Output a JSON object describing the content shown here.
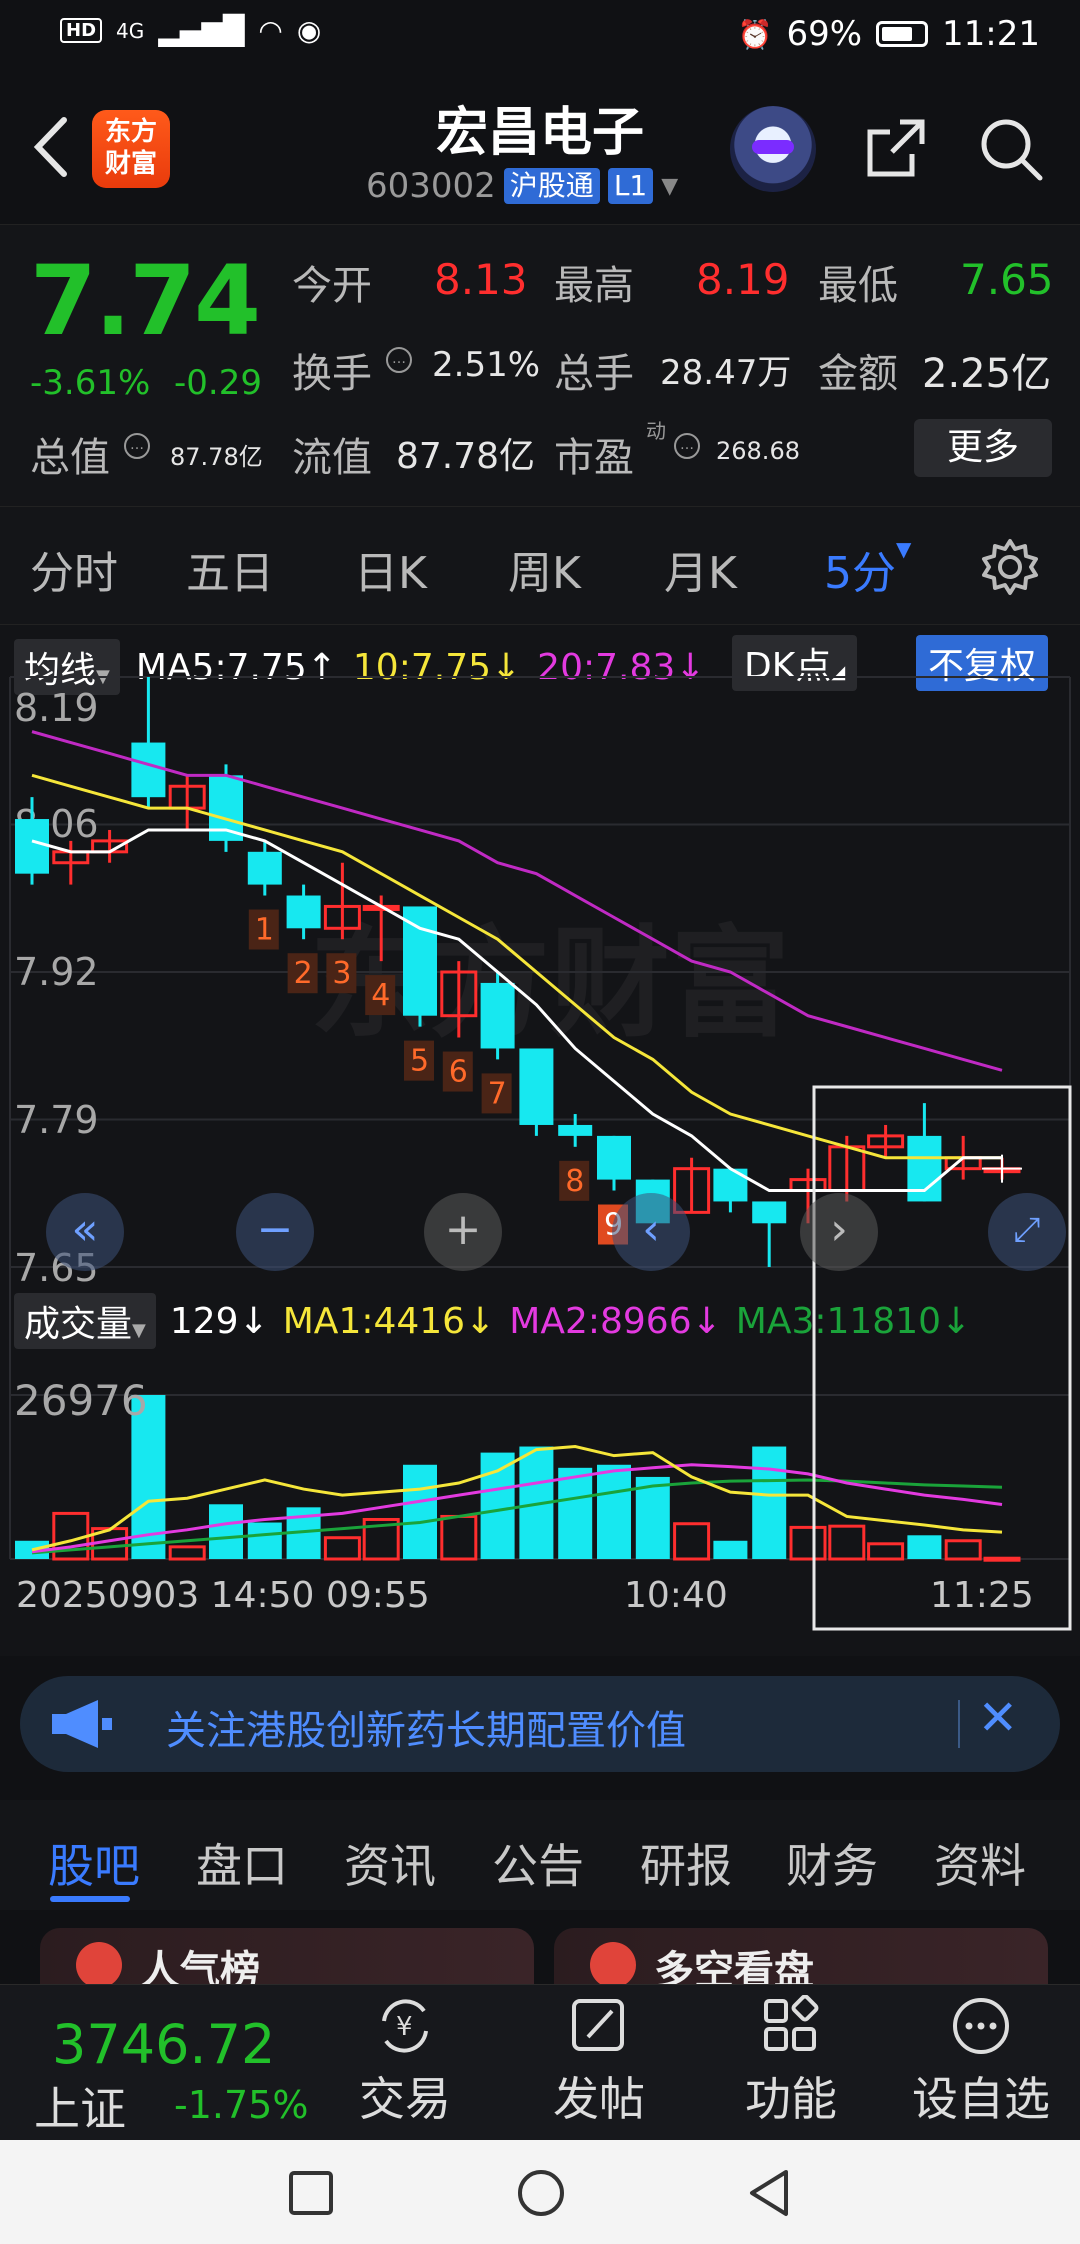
{
  "status_bar": {
    "network": "4G",
    "hd": "HD",
    "battery": "69%",
    "time": "11:21"
  },
  "header": {
    "logo_line1": "东方",
    "logo_line2": "财富",
    "stock_name": "宏昌电子",
    "stock_code": "603002",
    "tag_market": "沪股通",
    "tag_level": "L1"
  },
  "quote": {
    "price": "7.74",
    "change_pct": "-3.61%",
    "change_abs": "-0.29",
    "labels": {
      "open": "今开",
      "high": "最高",
      "low": "最低",
      "turnover": "换手",
      "volume": "总手",
      "amount": "金额",
      "total_cap": "总值",
      "float_cap": "流值",
      "pe": "市盈",
      "pe_sup": "动"
    },
    "values": {
      "open": "8.13",
      "high": "8.19",
      "low": "7.65",
      "turnover": "2.51%",
      "volume": "28.47万",
      "amount": "2.25亿",
      "total_cap": "87.78亿",
      "float_cap": "87.78亿",
      "pe": "268.68"
    },
    "more_label": "更多"
  },
  "period_tabs": [
    "分时",
    "五日",
    "日K",
    "周K",
    "月K",
    "5分"
  ],
  "chart_header": {
    "ma_button": "均线",
    "ma5": "MA5:7.75↑",
    "ma10": "10:7.75↓",
    "ma20": "20:7.83↓",
    "dk_button": "DK点",
    "adjust_button": "不复权"
  },
  "price_axis": [
    "8.19",
    "8.06",
    "7.92",
    "7.79",
    "7.65"
  ],
  "volume_header": {
    "label": "成交量",
    "current": "129↓",
    "ma1": "MA1:4416↓",
    "ma2": "MA2:8966↓",
    "ma3": "MA3:11810↓"
  },
  "volume_axis_max": "26976",
  "time_axis": {
    "start": "20250903 14:50",
    "t1": "09:55",
    "t2": "10:40",
    "t3": "11:25"
  },
  "watermark": "东方财富",
  "chart_data": {
    "type": "candlestick",
    "ylim": [
      7.65,
      8.19
    ],
    "candles": [
      {
        "o": 8.06,
        "c": 8.01,
        "h": 8.08,
        "l": 8.0,
        "v": 3000,
        "n": ""
      },
      {
        "o": 8.02,
        "c": 8.03,
        "h": 8.04,
        "l": 8.0,
        "v": 7500,
        "n": ""
      },
      {
        "o": 8.03,
        "c": 8.04,
        "h": 8.05,
        "l": 8.02,
        "v": 5000,
        "n": ""
      },
      {
        "o": 8.13,
        "c": 8.08,
        "h": 8.19,
        "l": 8.07,
        "v": 26976,
        "n": ""
      },
      {
        "o": 8.07,
        "c": 8.09,
        "h": 8.1,
        "l": 8.05,
        "v": 2000,
        "n": ""
      },
      {
        "o": 8.1,
        "c": 8.04,
        "h": 8.11,
        "l": 8.03,
        "v": 9000,
        "n": ""
      },
      {
        "o": 8.03,
        "c": 8.0,
        "h": 8.04,
        "l": 7.99,
        "v": 6000,
        "n": "1"
      },
      {
        "o": 7.99,
        "c": 7.96,
        "h": 8.0,
        "l": 7.95,
        "v": 8500,
        "n": "2"
      },
      {
        "o": 7.96,
        "c": 7.98,
        "h": 8.02,
        "l": 7.95,
        "v": 3500,
        "n": "3"
      },
      {
        "o": 7.98,
        "c": 7.98,
        "h": 7.99,
        "l": 7.93,
        "v": 6500,
        "n": "4"
      },
      {
        "o": 7.98,
        "c": 7.88,
        "h": 7.98,
        "l": 7.87,
        "v": 15500,
        "n": "5"
      },
      {
        "o": 7.88,
        "c": 7.92,
        "h": 7.93,
        "l": 7.86,
        "v": 7000,
        "n": "6"
      },
      {
        "o": 7.91,
        "c": 7.85,
        "h": 7.92,
        "l": 7.84,
        "v": 17500,
        "n": "7"
      },
      {
        "o": 7.85,
        "c": 7.78,
        "h": 7.85,
        "l": 7.77,
        "v": 18500,
        "n": ""
      },
      {
        "o": 7.78,
        "c": 7.77,
        "h": 7.79,
        "l": 7.76,
        "v": 15000,
        "n": "8"
      },
      {
        "o": 7.77,
        "c": 7.73,
        "h": 7.77,
        "l": 7.72,
        "v": 15500,
        "n": "9"
      },
      {
        "o": 7.73,
        "c": 7.69,
        "h": 7.73,
        "l": 7.69,
        "v": 13500,
        "n": ""
      },
      {
        "o": 7.7,
        "c": 7.74,
        "h": 7.75,
        "l": 7.7,
        "v": 5800,
        "n": ""
      },
      {
        "o": 7.74,
        "c": 7.71,
        "h": 7.74,
        "l": 7.7,
        "v": 3000,
        "n": ""
      },
      {
        "o": 7.71,
        "c": 7.69,
        "h": 7.71,
        "l": 7.65,
        "v": 18500,
        "n": ""
      },
      {
        "o": 7.72,
        "c": 7.73,
        "h": 7.74,
        "l": 7.69,
        "v": 5200,
        "n": ""
      },
      {
        "o": 7.72,
        "c": 7.76,
        "h": 7.77,
        "l": 7.71,
        "v": 5400,
        "n": ""
      },
      {
        "o": 7.76,
        "c": 7.77,
        "h": 7.78,
        "l": 7.75,
        "v": 2500,
        "n": ""
      },
      {
        "o": 7.77,
        "c": 7.71,
        "h": 7.8,
        "l": 7.71,
        "v": 3900,
        "n": ""
      },
      {
        "o": 7.74,
        "c": 7.75,
        "h": 7.77,
        "l": 7.73,
        "v": 3000,
        "n": ""
      },
      {
        "o": 7.74,
        "c": 7.74,
        "h": 7.75,
        "l": 7.73,
        "v": 129,
        "n": ""
      }
    ],
    "ma5": [
      8.04,
      8.03,
      8.03,
      8.05,
      8.05,
      8.05,
      8.04,
      8.02,
      8.0,
      7.98,
      7.96,
      7.95,
      7.92,
      7.89,
      7.85,
      7.82,
      7.79,
      7.77,
      7.74,
      7.72,
      7.72,
      7.72,
      7.72,
      7.72,
      7.75,
      7.75
    ],
    "ma10": [
      8.1,
      8.09,
      8.08,
      8.07,
      8.07,
      8.06,
      8.05,
      8.04,
      8.03,
      8.01,
      7.99,
      7.97,
      7.95,
      7.92,
      7.89,
      7.86,
      7.84,
      7.81,
      7.79,
      7.78,
      7.77,
      7.76,
      7.75,
      7.75,
      7.75,
      7.75
    ],
    "ma20": [
      8.14,
      8.13,
      8.12,
      8.11,
      8.1,
      8.1,
      8.09,
      8.08,
      8.07,
      8.06,
      8.05,
      8.04,
      8.02,
      8.01,
      7.99,
      7.97,
      7.95,
      7.93,
      7.92,
      7.9,
      7.88,
      7.87,
      7.86,
      7.85,
      7.84,
      7.83
    ],
    "vol_ma1": [
      1500,
      3000,
      4800,
      9500,
      10000,
      11500,
      13000,
      11500,
      10500,
      11000,
      11500,
      12500,
      14500,
      18000,
      18500,
      17000,
      17500,
      13500,
      11000,
      10500,
      10500,
      7000,
      6300,
      5600,
      4800,
      4416
    ],
    "vol_ma2": [
      1200,
      2000,
      3000,
      4000,
      4800,
      5800,
      6500,
      7000,
      7500,
      8500,
      9500,
      10500,
      11500,
      12500,
      13500,
      14500,
      15000,
      15500,
      15200,
      14800,
      14000,
      12500,
      11500,
      10500,
      9800,
      8966
    ],
    "vol_ma3": [
      1000,
      1500,
      2000,
      2500,
      3000,
      3500,
      4000,
      4500,
      5000,
      5500,
      6000,
      7000,
      8000,
      9000,
      10000,
      11000,
      12000,
      12500,
      12800,
      12900,
      13000,
      12800,
      12500,
      12200,
      12000,
      11810
    ],
    "vol_ylim": [
      0,
      26976
    ]
  },
  "banner": {
    "text": "关注港股创新药长期配置价值"
  },
  "content_tabs": [
    "股吧",
    "盘口",
    "资讯",
    "公告",
    "研报",
    "财务",
    "资料"
  ],
  "cards": [
    "人气榜",
    "多空看盘"
  ],
  "bottom_nav": {
    "index_value": "3746.72",
    "index_name": "上证",
    "index_change": "-1.75%",
    "items": [
      "交易",
      "发帖",
      "功能",
      "设自选"
    ]
  },
  "colors": {
    "up": "#ff2e2e",
    "down": "#22c02a",
    "candle_down": "#17e8f0",
    "accent": "#3a7bff"
  }
}
